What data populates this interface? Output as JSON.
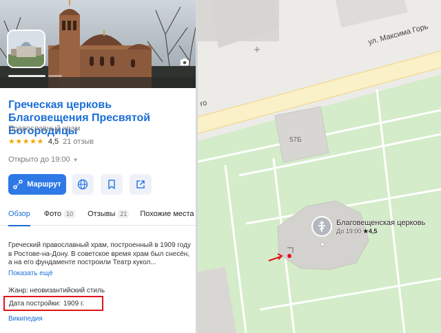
{
  "place": {
    "photo_count": "10",
    "title": "Греческая церковь Благовещения Пресвятой Богородицы",
    "category": "Православный храм",
    "stars": "★★★★★",
    "rating": "4,5",
    "reviews": "21 отзыв",
    "hours": "Открыто до 19:00",
    "hours_caret": "▼"
  },
  "actions": {
    "route_label": "Маршрут"
  },
  "tabs": [
    {
      "label": "Обзор"
    },
    {
      "label": "Фото",
      "badge": "10"
    },
    {
      "label": "Отзывы",
      "badge": "21"
    },
    {
      "label": "Похожие места"
    }
  ],
  "overview": {
    "description": "Греческий православный храм, построенный в 1909 году в Ростове-на-Дону. В советское время храм был снесён, а на его фундаменте построили Театр кукол...",
    "show_more": "Показать ещё",
    "genre": "Жанр: неовизантийский стиль",
    "built_label": "Дата постройки:",
    "built_value": "1909 г.",
    "wiki": "Википедия"
  },
  "map": {
    "street": "ул. Максима Горь",
    "street_fragment": "го",
    "house_number": "57Б",
    "poi_name": "Благовещенская церковь",
    "poi_hours": "До 19:00",
    "poi_rating": "★4,5"
  },
  "colors": {
    "link": "#1a6ed8",
    "primary_button": "#2e79e6",
    "highlight_box": "#e0121b",
    "star": "#f0a800"
  }
}
